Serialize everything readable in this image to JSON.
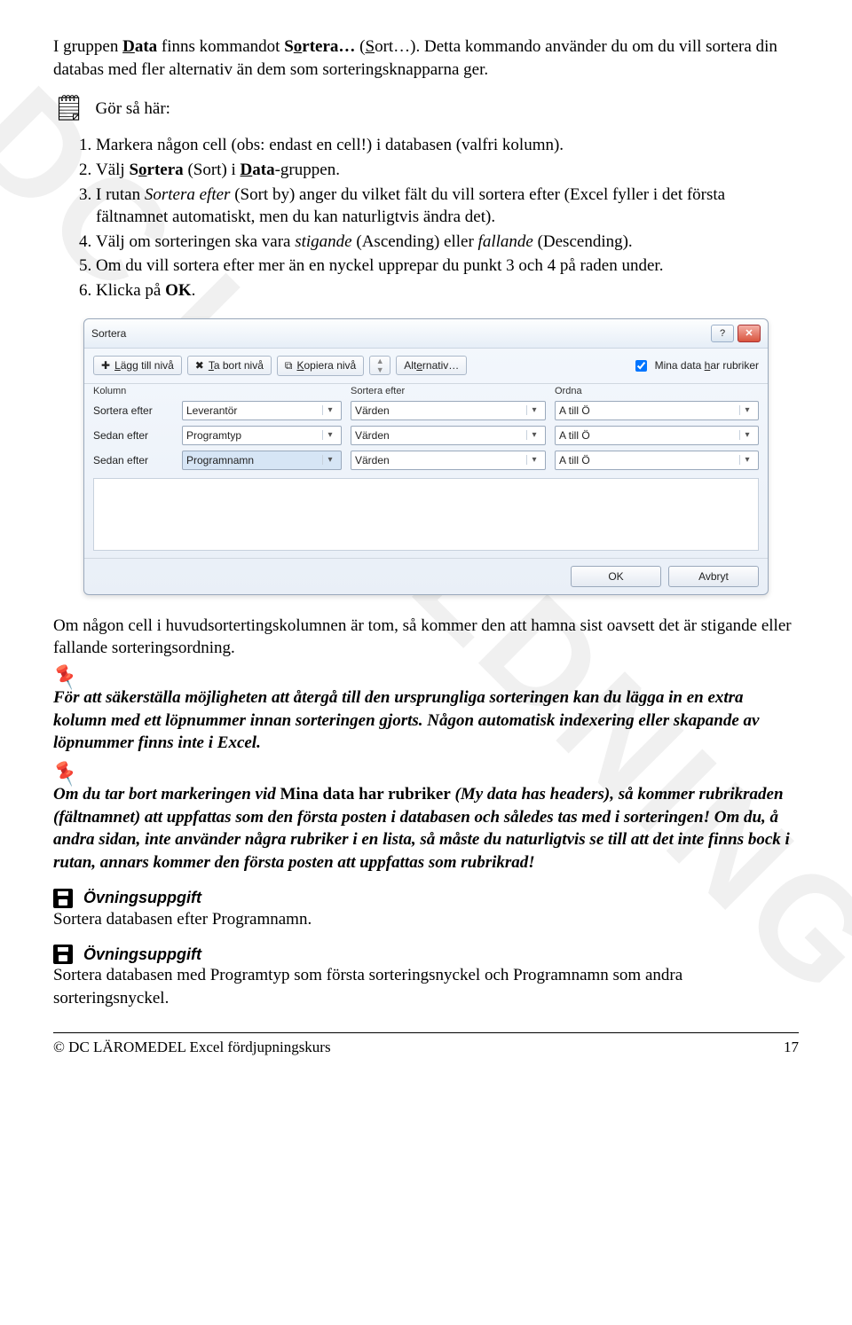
{
  "watermark": "DC UTBILDNING",
  "intro": {
    "pre": "I gruppen ",
    "b1": "Data",
    "mid1": " finns kommandot ",
    "b2": "Sortera…",
    "mid2": " (",
    "u1": "S",
    "mid3": "ort…). Detta kommando använder du om du vill sortera din databas med fler alternativ än dem som sorteringsknapparna ger."
  },
  "do_heading": "Gör så här:",
  "steps": [
    "Markera någon cell (obs: endast en cell!) i databasen (valfri kolumn).",
    {
      "pre": "Välj ",
      "b1": "Sortera",
      "mid1": " (Sort) i ",
      "b2": "Data",
      "post": "-gruppen."
    },
    {
      "pre": "I rutan ",
      "i1": "Sortera efter",
      "post": " (Sort by) anger du vilket fält du vill sortera efter (Excel fyller i det första fältnamnet automatiskt, men du kan naturligtvis ändra det)."
    },
    {
      "pre": "Välj om sorteringen ska vara ",
      "i1": "stigande",
      "mid1": " (Ascending) eller ",
      "i2": "fallande",
      "post": " (Descending)."
    },
    "Om du vill sortera efter mer än en nyckel upprepar du punkt 3 och 4 på raden under.",
    {
      "pre": "Klicka på ",
      "b1": "OK",
      "post": "."
    }
  ],
  "dialog": {
    "title": "Sortera",
    "buttons": {
      "add": "Lägg till nivå",
      "del": "Ta bort nivå",
      "copy": "Kopiera nivå",
      "options": "Alternativ…",
      "headers": "Mina data har rubriker",
      "ok": "OK",
      "cancel": "Avbryt"
    },
    "head": {
      "col1": "Kolumn",
      "col2": "Sortera efter",
      "col3": "Ordna"
    },
    "rows": [
      {
        "label": "Sortera efter",
        "column": "Leverantör",
        "by": "Värden",
        "order": "A till Ö",
        "selected": false
      },
      {
        "label": "Sedan efter",
        "column": "Programtyp",
        "by": "Värden",
        "order": "A till Ö",
        "selected": false
      },
      {
        "label": "Sedan efter",
        "column": "Programnamn",
        "by": "Värden",
        "order": "A till Ö",
        "selected": true
      }
    ]
  },
  "after_dialog": "Om någon cell i huvudsortertingskolumnen är tom, så kommer den att hamna sist oavsett det är stigande eller fallande sorteringsordning.",
  "tip1": "För att säkerställa möjligheten att återgå till den ursprungliga sorteringen kan du lägga in en extra kolumn med ett löpnummer innan sorteringen gjorts. Någon automatisk indexering eller skapande av löpnummer finns inte i Excel.",
  "tip2": {
    "pre": "Om du tar bort markeringen vid ",
    "b1": "Mina data har rubriker",
    "mid1": " (My data has headers), så kommer rubrikraden (fältnamnet) att uppfattas som den första posten i databasen och således tas med i sorteringen! Om du, å andra sidan, inte använder några rubriker i en lista, så måste du naturligtvis se till att det inte finns bock i rutan, annars kommer den första posten att uppfattas som rubrikrad!"
  },
  "exercise_label": "Övningsuppgift",
  "exercise1": "Sortera databasen efter Programnamn.",
  "exercise2": "Sortera databasen med Programtyp som första sorteringsnyckel och Programnamn som andra sorteringsnyckel.",
  "footer": {
    "left": "©  DC  LÄROMEDEL  Excel fördjupningskurs",
    "right": "17"
  }
}
